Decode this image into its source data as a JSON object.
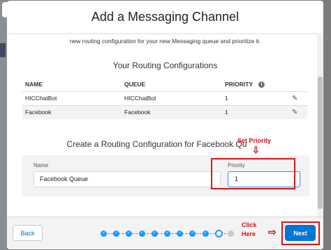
{
  "modal": {
    "title": "Add a Messaging Channel",
    "intro_text": "new routing configuration for your new Messaging queue and prioritize it."
  },
  "routing_configurations": {
    "title": "Your Routing Configurations",
    "columns": [
      "NAME",
      "QUEUE",
      "PRIORITY"
    ],
    "rows": [
      {
        "name": "HICChatBot",
        "queue": "HICChatBot",
        "priority": "1"
      },
      {
        "name": "Facebook",
        "queue": "Facebook",
        "priority": "1"
      }
    ]
  },
  "create_form": {
    "title": "Create a Routing Configuration for Facebook Qu",
    "name_label": "Name",
    "name_value": "Facebook Queue",
    "priority_label": "Priority",
    "priority_value": "1"
  },
  "annotations": {
    "set_priority": "Set Priority",
    "click_here_line1": "Click",
    "click_here_line2": "Here"
  },
  "footer": {
    "back_label": "Back",
    "next_label": "Next",
    "progress": {
      "completed_steps": 9,
      "current_step": 10,
      "total_steps": 11
    }
  },
  "icons": {
    "close": "close-icon",
    "info": "info-icon",
    "edit": "pencil-icon",
    "arrow": "arrow-icon",
    "check": "check-icon"
  },
  "colors": {
    "accent": "#0176d3",
    "progress": "#1b96ff",
    "annotation": "#e0131b"
  }
}
